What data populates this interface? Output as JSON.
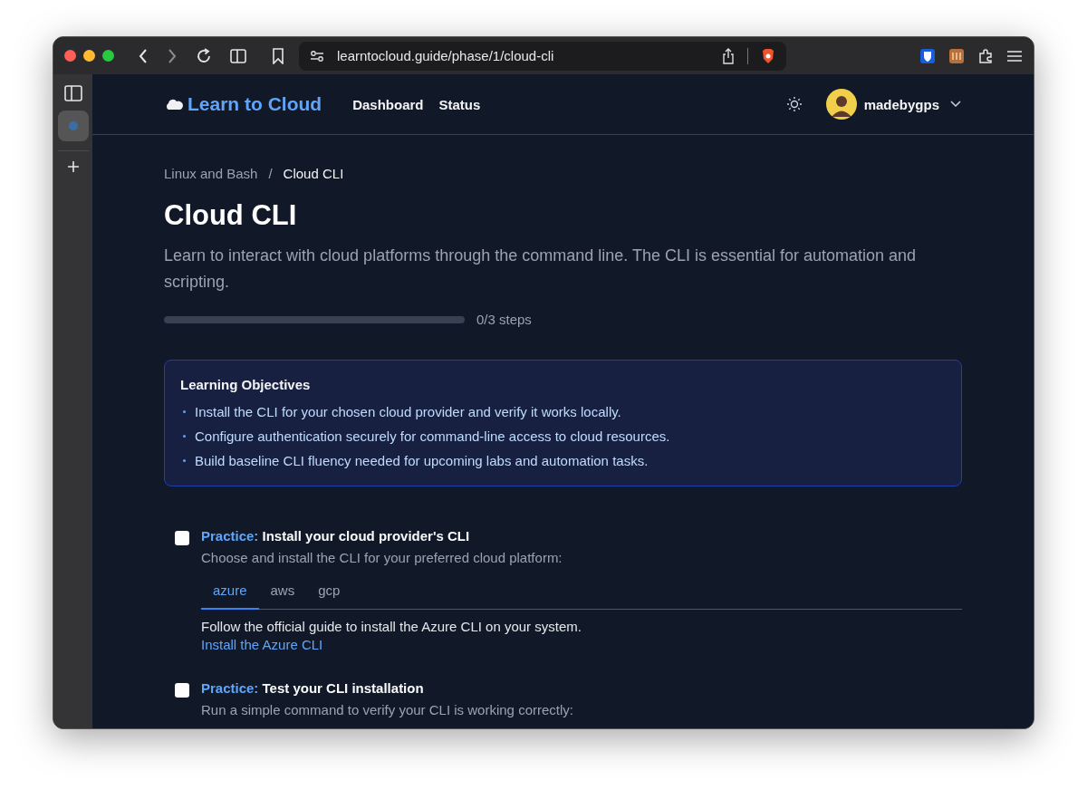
{
  "browser": {
    "url": "learntocloud.guide/phase/1/cloud-cli"
  },
  "header": {
    "logo": "Learn to Cloud",
    "nav": [
      {
        "label": "Dashboard"
      },
      {
        "label": "Status"
      }
    ],
    "user": "madebygps"
  },
  "breadcrumb": {
    "separator": "/",
    "items": [
      {
        "label": "Linux and Bash",
        "current": false
      },
      {
        "label": "Cloud CLI",
        "current": true
      }
    ]
  },
  "title": "Cloud CLI",
  "description": "Learn to interact with cloud platforms through the command line. The CLI is essential for automation and scripting.",
  "progress": {
    "level": 0,
    "label": "0/3 steps"
  },
  "objectives": {
    "title": "Learning Objectives",
    "items": [
      "Install the CLI for your chosen cloud provider and verify it works locally.",
      "Configure authentication securely for command-line access to cloud resources.",
      "Build baseline CLI fluency needed for upcoming labs and automation tasks."
    ]
  },
  "steps": [
    {
      "checked": false,
      "tag": "Practice:",
      "title": "Install your cloud provider's CLI",
      "text": "Choose and install the CLI for your preferred cloud platform:",
      "tabs": [
        {
          "label": "azure",
          "selected": true
        },
        {
          "label": "aws",
          "selected": false
        },
        {
          "label": "gcp",
          "selected": false
        }
      ],
      "body": "Follow the official guide to install the Azure CLI on your system.",
      "link": "Install the Azure CLI"
    },
    {
      "checked": false,
      "tag": "Practice:",
      "title": "Test your CLI installation",
      "text": "Run a simple command to verify your CLI is working correctly:"
    }
  ]
}
